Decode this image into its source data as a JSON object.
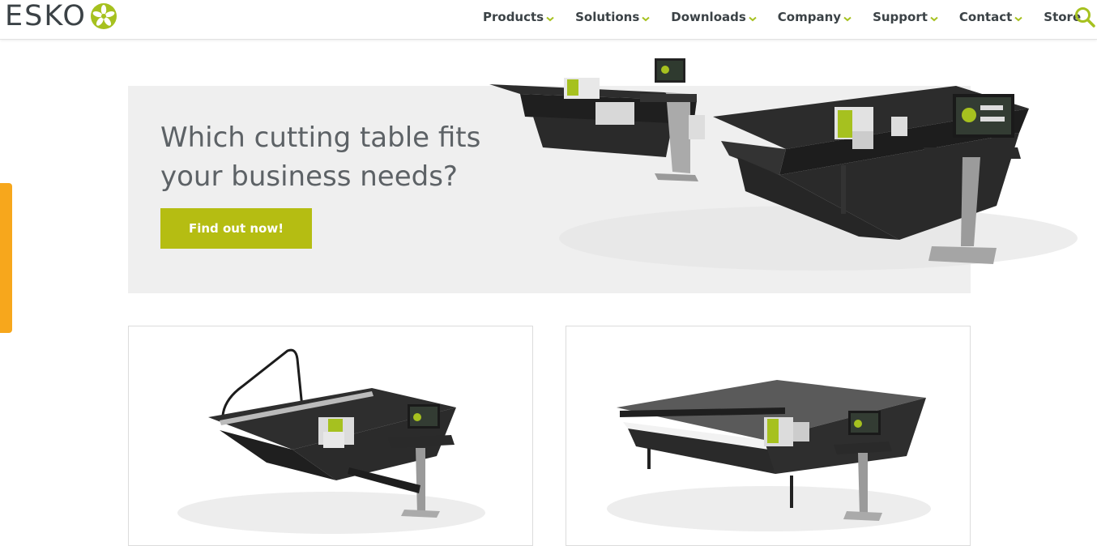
{
  "brand": {
    "name": "ESKO",
    "accent": "#b5bd12",
    "dark": "#3b4246"
  },
  "nav": {
    "items": [
      {
        "label": "Products",
        "has_dropdown": true
      },
      {
        "label": "Solutions",
        "has_dropdown": true
      },
      {
        "label": "Downloads",
        "has_dropdown": true
      },
      {
        "label": "Company",
        "has_dropdown": true
      },
      {
        "label": "Support",
        "has_dropdown": true
      },
      {
        "label": "Contact",
        "has_dropdown": true
      },
      {
        "label": "Store",
        "has_dropdown": false
      }
    ],
    "search_icon": "search-icon"
  },
  "side_tab": {
    "color": "#f7a71c"
  },
  "hero": {
    "heading": "Which cutting table fits your business needs?",
    "button_label": "Find out now!",
    "background": "#efefef"
  },
  "cards": [
    {
      "image": "cutting-table-with-cable-arm"
    },
    {
      "image": "large-cutting-table-with-monitor"
    }
  ]
}
